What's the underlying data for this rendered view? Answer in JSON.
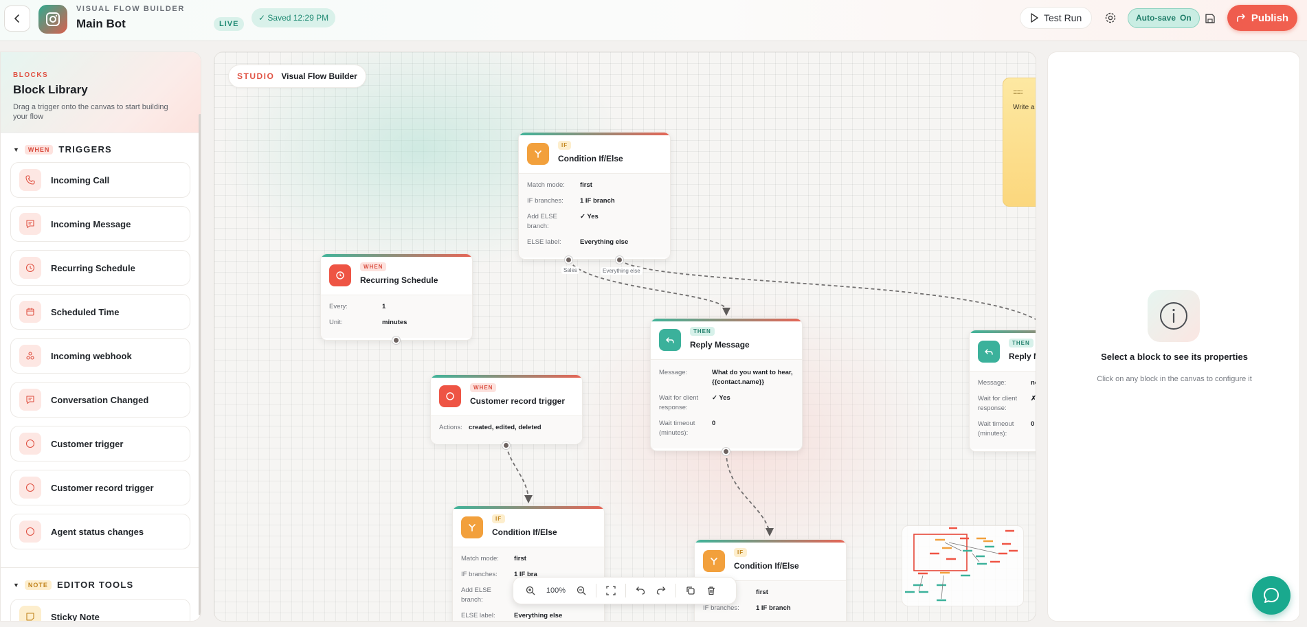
{
  "header": {
    "eyebrow": "VISUAL FLOW BUILDER",
    "bot_name": "Main Bot",
    "live_badge": "LIVE",
    "saved_status": "✓ Saved 12:29 PM",
    "test_run_label": "Test Run",
    "autosave_label": "Auto-save",
    "autosave_state": "On",
    "publish_label": "Publish"
  },
  "sidebar": {
    "eyebrow": "BLOCKS",
    "title": "Block Library",
    "description": "Drag a trigger onto the canvas to start building your flow",
    "triggers_section": {
      "tag": "WHEN",
      "label": "TRIGGERS"
    },
    "triggers": [
      {
        "label": "Incoming Call",
        "icon": "phone-icon"
      },
      {
        "label": "Incoming Message",
        "icon": "message-icon"
      },
      {
        "label": "Recurring Schedule",
        "icon": "clock-icon"
      },
      {
        "label": "Scheduled Time",
        "icon": "calendar-icon"
      },
      {
        "label": "Incoming webhook",
        "icon": "webhook-icon"
      },
      {
        "label": "Conversation Changed",
        "icon": "message-icon"
      },
      {
        "label": "Customer trigger",
        "icon": "circle-icon"
      },
      {
        "label": "Customer record trigger",
        "icon": "circle-icon"
      },
      {
        "label": "Agent status changes",
        "icon": "circle-icon"
      }
    ],
    "tools_section": {
      "tag": "NOTE",
      "label": "EDITOR TOOLS"
    },
    "tools": [
      {
        "label": "Sticky Note",
        "icon": "sticky-note-icon"
      }
    ]
  },
  "canvas": {
    "studio_label": "STUDIO",
    "studio_title": "Visual Flow Builder",
    "nodes": {
      "condition_top": {
        "tag": "IF",
        "title": "Condition If/Else",
        "props": [
          {
            "k": "Match mode:",
            "v": "first"
          },
          {
            "k": "IF branches:",
            "v": "1 IF branch"
          },
          {
            "k": "Add ELSE branch:",
            "v": "✓ Yes"
          },
          {
            "k": "ELSE label:",
            "v": "Everything else"
          }
        ],
        "port_labels": [
          "Sales",
          "Everything else"
        ]
      },
      "recurring": {
        "tag": "WHEN",
        "title": "Recurring Schedule",
        "props": [
          {
            "k": "Every:",
            "v": "1"
          },
          {
            "k": "Unit:",
            "v": "minutes"
          }
        ]
      },
      "customer_record": {
        "tag": "WHEN",
        "title": "Customer record trigger",
        "props": [
          {
            "k": "Actions:",
            "v": "created, edited, deleted"
          }
        ]
      },
      "reply": {
        "tag": "THEN",
        "title": "Reply Message",
        "props": [
          {
            "k": "Message:",
            "v": "What do you want to hear, {{contact.name}}"
          },
          {
            "k": "Wait for client response:",
            "v": "✓ Yes"
          },
          {
            "k": "Wait timeout (minutes):",
            "v": "0"
          }
        ]
      },
      "reply_right": {
        "tag": "THEN",
        "title": "Reply Me",
        "props": [
          {
            "k": "Message:",
            "v": "no"
          },
          {
            "k": "Wait for client response:",
            "v": "✗ I"
          },
          {
            "k": "Wait timeout (minutes):",
            "v": "0"
          }
        ]
      },
      "condition_bottom_left": {
        "tag": "IF",
        "title": "Condition If/Else",
        "props": [
          {
            "k": "Match mode:",
            "v": "first"
          },
          {
            "k": "IF branches:",
            "v": "1 IF bra"
          },
          {
            "k": "Add ELSE branch:",
            "v": ""
          },
          {
            "k": "ELSE label:",
            "v": "Everything else"
          }
        ]
      },
      "condition_bottom_right": {
        "tag": "IF",
        "title": "Condition If/Else",
        "props": [
          {
            "k": "",
            "v": "first"
          },
          {
            "k": "IF branches:",
            "v": "1 IF branch"
          }
        ]
      }
    },
    "sticky_note": {
      "grip": ";;;;;;;;;;;",
      "text": "Write a n"
    },
    "toolbar": {
      "zoom": "100%"
    }
  },
  "properties_panel": {
    "empty_title": "Select a block to see its properties",
    "empty_subtitle": "Click on any block in the canvas to configure it"
  },
  "colors": {
    "accent_red": "#ee5444",
    "accent_teal": "#3bb19b",
    "accent_orange": "#f2a03c"
  }
}
